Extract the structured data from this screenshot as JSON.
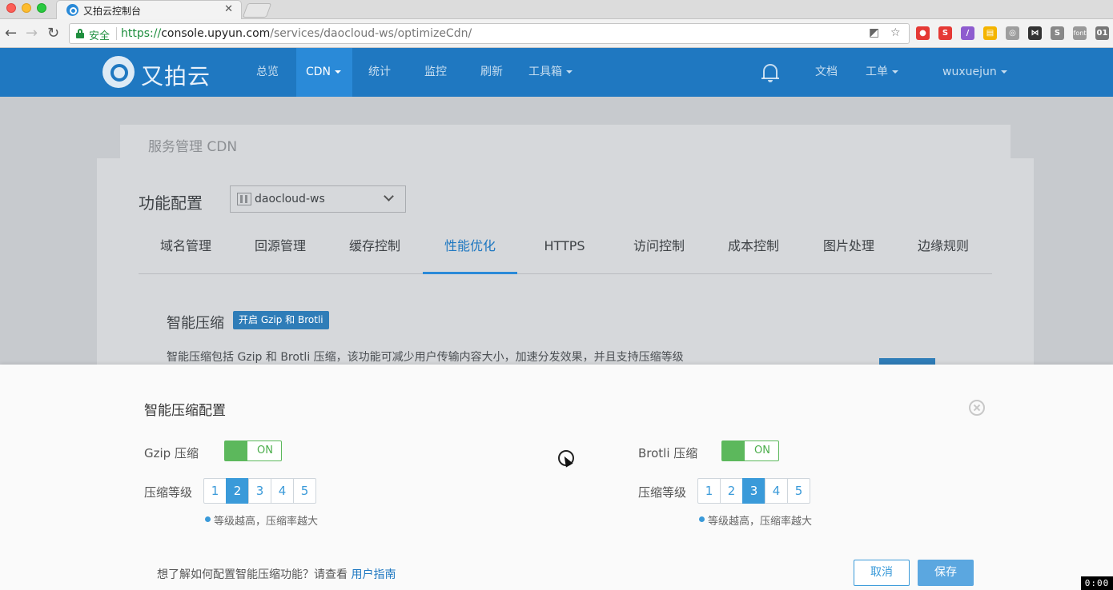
{
  "browser": {
    "tab_title": "又拍云控制台",
    "tab_close": "✕",
    "secure_label": "安全",
    "url_scheme": "https://",
    "url_host": "console.upyun.com",
    "url_path": "/services/daocloud-ws/optimizeCdn/",
    "extensions": [
      {
        "name": "adblock-ext",
        "color": "#e53935",
        "label": "●"
      },
      {
        "name": "s-ext",
        "color": "#e53935",
        "label": "S"
      },
      {
        "name": "feather-ext",
        "color": "#8e5ccf",
        "label": "/"
      },
      {
        "name": "grid-ext",
        "color": "#f4b400",
        "label": "▤"
      },
      {
        "name": "circle-ext",
        "color": "#9e9e9e",
        "label": "◎"
      },
      {
        "name": "network-ext",
        "color": "#333333",
        "label": "⋈"
      },
      {
        "name": "s-gray-ext",
        "color": "#888888",
        "label": "S"
      },
      {
        "name": "font-ext",
        "color": "#999999",
        "label": "font"
      },
      {
        "name": "counter-ext",
        "color": "#777777",
        "label": "01"
      }
    ]
  },
  "header": {
    "brand": "又拍云",
    "nav": [
      {
        "label": "总览",
        "dropdown": false
      },
      {
        "label": "CDN",
        "dropdown": true,
        "active": true
      },
      {
        "label": "统计",
        "dropdown": false
      },
      {
        "label": "监控",
        "dropdown": false
      },
      {
        "label": "刷新",
        "dropdown": false
      },
      {
        "label": "工具箱",
        "dropdown": true
      }
    ],
    "docs": "文档",
    "ticket": "工单",
    "user": "wuxuejun"
  },
  "page": {
    "service_title": "服务管理 CDN",
    "function_title": "功能配置",
    "service_select": "daocloud-ws",
    "tabs": [
      "域名管理",
      "回源管理",
      "缓存控制",
      "性能优化",
      "HTTPS",
      "访问控制",
      "成本控制",
      "图片处理",
      "边缘规则"
    ],
    "active_tab": "性能优化",
    "section_title": "智能压缩",
    "section_badge": "开启 Gzip 和 Brotli",
    "section_desc": "智能压缩包括 Gzip 和 Brotli 压缩，该功能可减少用户传输内容大小，加速分发效果，并且支持压缩等级"
  },
  "modal": {
    "title": "智能压缩配置",
    "gzip": {
      "label": "Gzip 压缩",
      "toggle": "ON",
      "level_label": "压缩等级",
      "levels": [
        "1",
        "2",
        "3",
        "4",
        "5"
      ],
      "selected_level": 2,
      "hint": "等级越高，压缩率越大"
    },
    "brotli": {
      "label": "Brotli 压缩",
      "toggle": "ON",
      "level_label": "压缩等级",
      "levels": [
        "1",
        "2",
        "3",
        "4",
        "5"
      ],
      "selected_level": 3,
      "hint": "等级越高，压缩率越大"
    },
    "guide_text": "想了解如何配置智能压缩功能？请查看 ",
    "guide_link": "用户指南",
    "cancel": "取消",
    "save": "保存"
  },
  "timer": "0:00",
  "colors": {
    "brand_blue": "#1f78c1",
    "accent_blue": "#3a9ad9",
    "toggle_green": "#5cb85c"
  }
}
